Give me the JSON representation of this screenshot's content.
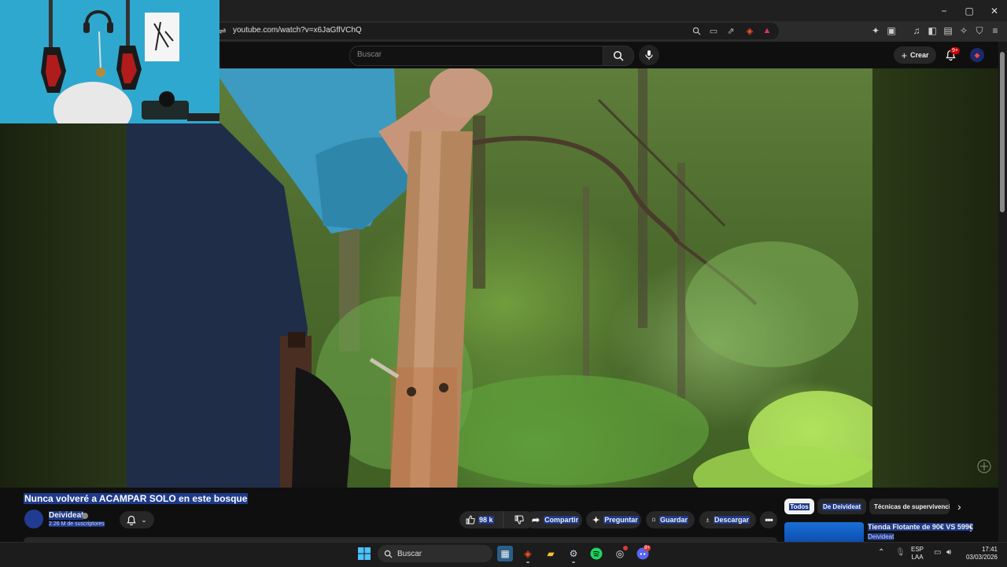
{
  "browser": {
    "url": "youtube.com/watch?v=x6JaGflVChQ",
    "window_controls": {
      "minimize": "−",
      "maximize": "▢",
      "close": "✕"
    }
  },
  "youtube": {
    "search_placeholder": "Buscar",
    "create_label": "Crear",
    "notifications_badge": "9+"
  },
  "video": {
    "title": "Nunca volveré a ACAMPAR SOLO en este bosque",
    "channel": "Deivideat",
    "subscribers": "2.26 M de suscriptores",
    "likes": "98 k",
    "actions": {
      "share": "Compartir",
      "ask": "Preguntar",
      "save": "Guardar",
      "download": "Descargar"
    }
  },
  "sidebar": {
    "chips": [
      "Todos",
      "De Deivideat",
      "Técnicas de supervivencia"
    ],
    "recommendation": {
      "title": "Tienda Flotante de 90€ VS 599€",
      "channel": "Deivideat"
    }
  },
  "taskbar": {
    "search_label": "Buscar",
    "lang": "ESP",
    "layout": "LAA",
    "time": "17:41",
    "date": "03/03/2026",
    "discord_badge": "9+"
  },
  "colors": {
    "selection_highlight": "#1e3a8a",
    "youtube_red": "#cc0000",
    "page_bg": "#0f0f0f"
  }
}
